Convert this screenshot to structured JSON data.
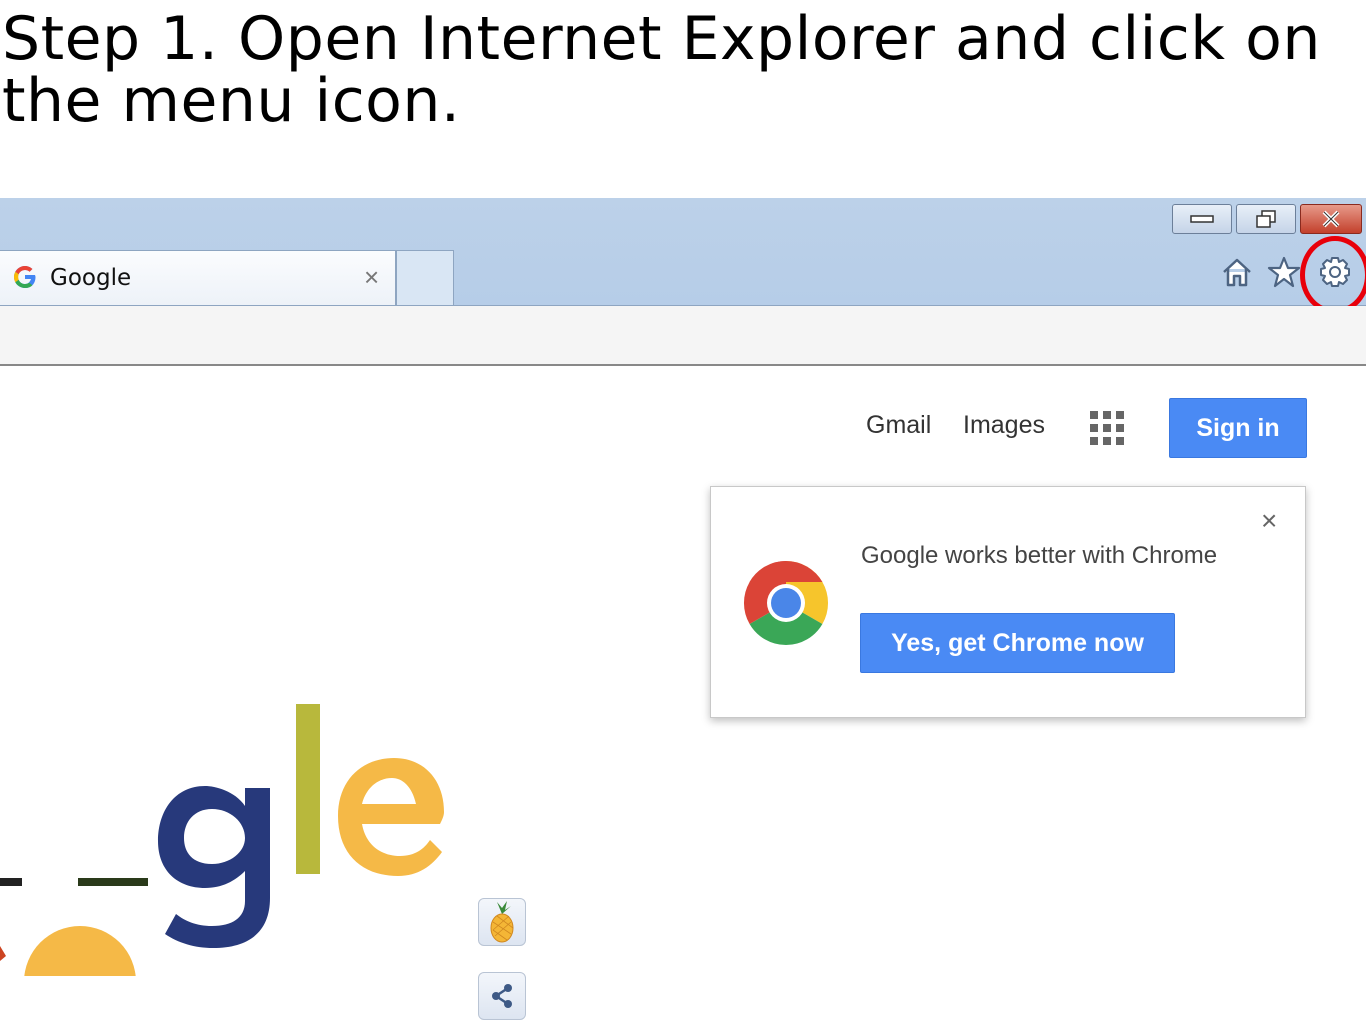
{
  "instruction": {
    "text": "Step 1. Open Internet Explorer and click on the menu icon."
  },
  "browser": {
    "tab": {
      "title": "Google",
      "icon": "google-g-icon",
      "close_glyph": "×"
    },
    "toolbar_icons": [
      "home-icon",
      "favorites-star-icon",
      "settings-gear-icon"
    ],
    "highlight_color": "#e8000a"
  },
  "page": {
    "links": {
      "gmail": "Gmail",
      "images": "Images"
    },
    "sign_in": "Sign in",
    "promo": {
      "message": "Google works better with Chrome",
      "button": "Yes, get Chrome now",
      "close_glyph": "×"
    }
  },
  "colors": {
    "accent_blue": "#4a8af4",
    "titlebar": "#b6cde8",
    "doodle_navy": "#27397b",
    "doodle_olive": "#b8b83c",
    "doodle_yellow": "#f5b947"
  }
}
